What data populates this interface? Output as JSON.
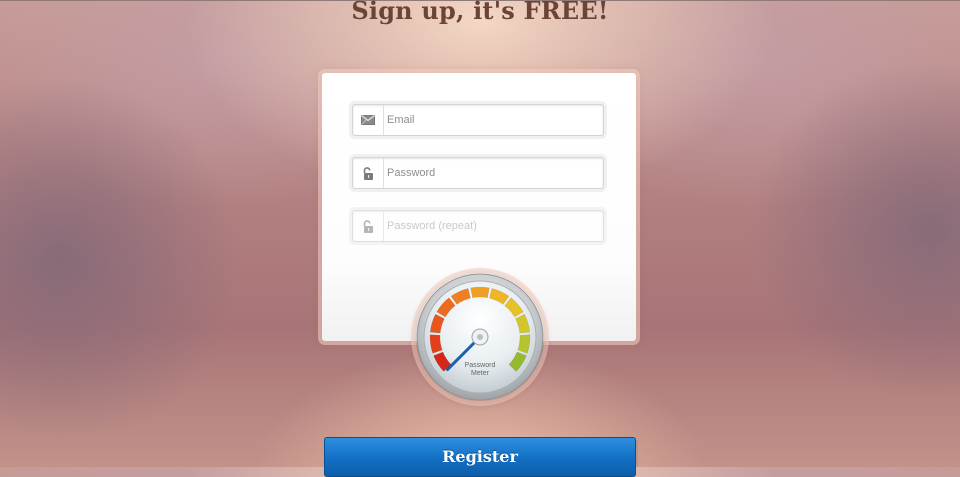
{
  "page": {
    "headline": "Sign up, it's FREE!"
  },
  "form": {
    "email": {
      "placeholder": "Email",
      "value": "",
      "icon": "envelope-icon"
    },
    "password": {
      "placeholder": "Password",
      "value": "",
      "icon": "unlocked-padlock-icon"
    },
    "password_repeat": {
      "placeholder": "Password (repeat)",
      "value": "",
      "icon": "unlocked-padlock-icon"
    }
  },
  "meter": {
    "label_line1": "Password",
    "label_line2": "Meter",
    "level": 0,
    "segment_colors": [
      "#d4261a",
      "#e2401c",
      "#e7561d",
      "#ec6b1f",
      "#ee7f22",
      "#efa023",
      "#efb523",
      "#e6c127",
      "#d2c62b",
      "#b6c52f",
      "#95b92f"
    ]
  },
  "actions": {
    "register_label": "Register"
  },
  "colors": {
    "accent": "#136fc4",
    "headline": "#6b4436"
  }
}
